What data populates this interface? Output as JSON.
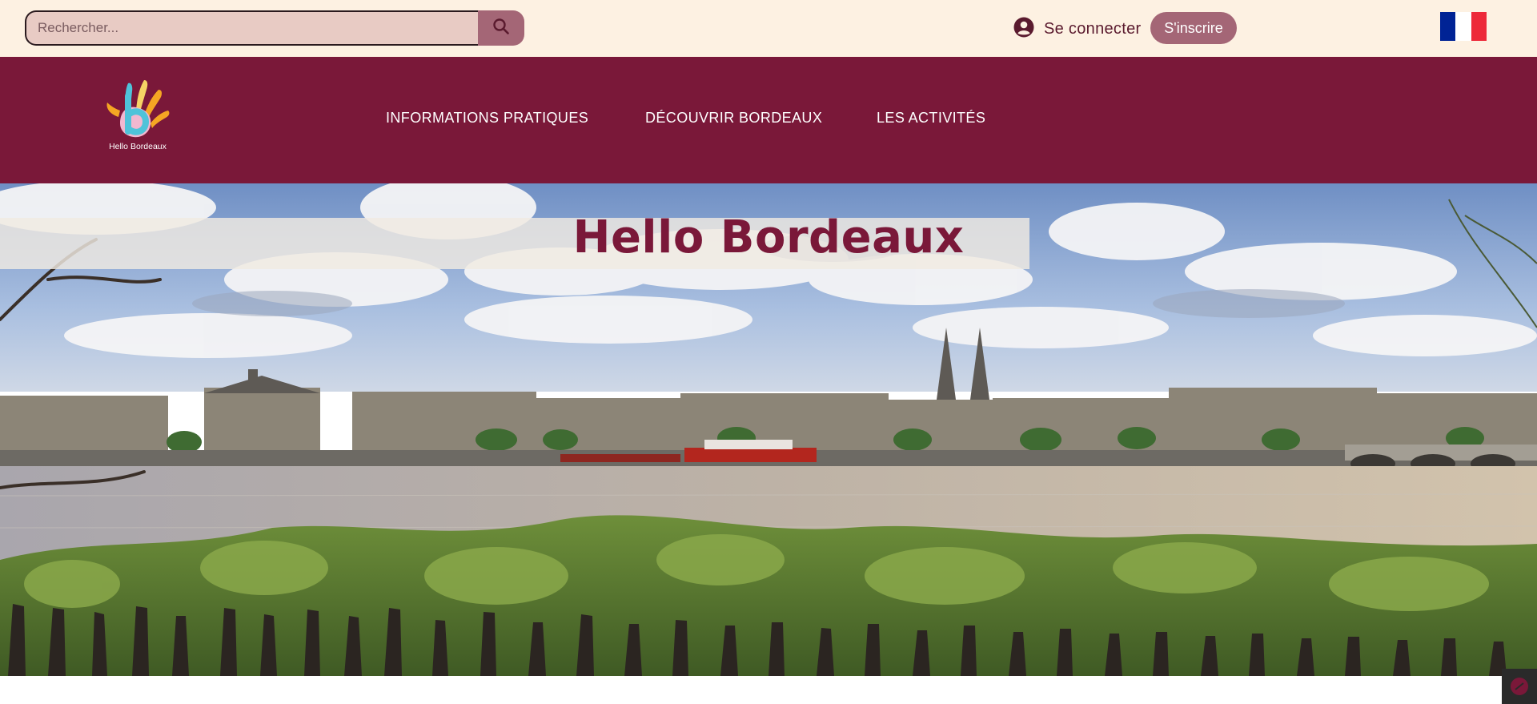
{
  "search": {
    "placeholder": "Rechercher...",
    "icon": "search-icon"
  },
  "auth": {
    "login_label": "Se connecter",
    "login_icon": "user-circle-icon",
    "signup_label": "S'inscrire"
  },
  "language": {
    "flag": "french-flag-icon",
    "colors": [
      "#002395",
      "#ffffff",
      "#ed2939"
    ]
  },
  "brand": {
    "logo_text": "Hello Bordeaux"
  },
  "nav": {
    "items": [
      {
        "label": "INFORMATIONS PRATIQUES"
      },
      {
        "label": "DÉCOUVRIR BORDEAUX"
      },
      {
        "label": "LES ACTIVITÉS"
      }
    ]
  },
  "hero": {
    "title": "Hello Bordeaux",
    "image": "bordeaux-riverfront-panorama"
  },
  "colors": {
    "topbar_bg": "#fdf1e2",
    "brand_primary": "#7a1839",
    "accent": "#a46676"
  }
}
